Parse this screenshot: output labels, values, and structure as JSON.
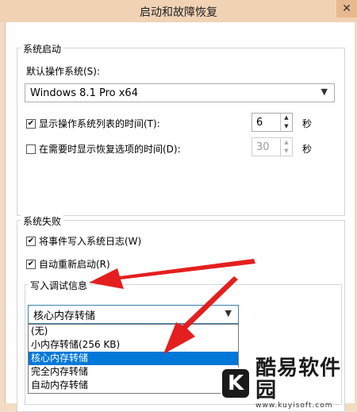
{
  "window": {
    "title": "启动和故障恢复",
    "close_glyph": "✕"
  },
  "startup": {
    "group_label": "系统启动",
    "default_os_label": "默认操作系统(S):",
    "default_os_value": "Windows 8.1 Pro x64",
    "show_list": {
      "label": "显示操作系统列表的时间(T):",
      "checked": true,
      "value": "6",
      "unit": "秒"
    },
    "show_recovery": {
      "label": "在需要时显示恢复选项的时间(D):",
      "checked": false,
      "value": "30",
      "unit": "秒"
    }
  },
  "failure": {
    "group_label": "系统失败",
    "write_event": {
      "label": "将事件写入系统日志(W)",
      "checked": true
    },
    "auto_restart": {
      "label": "自动重新启动(R)",
      "checked": true
    },
    "debug_group_label": "写入调试信息",
    "debug_value": "核心内存转储",
    "debug_options": [
      "(无)",
      "小内存转储(256 KB)",
      "核心内存转储",
      "完全内存转储",
      "自动内存转储"
    ],
    "debug_selected_index": 2
  },
  "watermark": {
    "logo": "K",
    "name": "酷易软件园",
    "url": "www.kuyisoft.com"
  }
}
